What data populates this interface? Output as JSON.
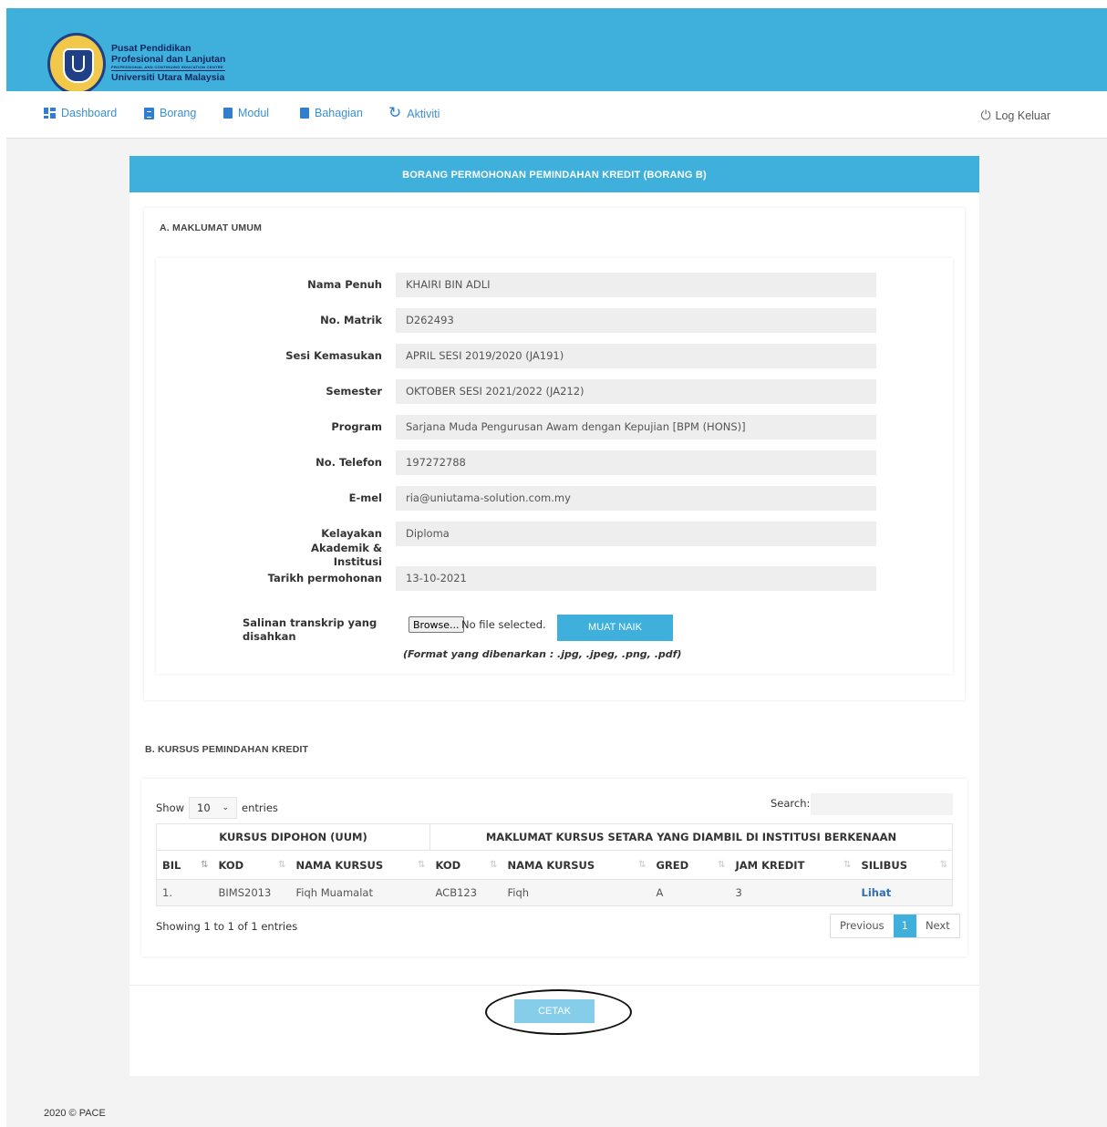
{
  "brand": {
    "line1": "Pusat Pendidikan",
    "line2": "Profesional dan Lanjutan",
    "line3": "PROFESSIONAL AND CONTINUING EDUCATION CENTRE",
    "line4": "Universiti Utara Malaysia"
  },
  "nav": {
    "items": [
      {
        "label": "Dashboard",
        "icon": "dashboard-icon"
      },
      {
        "label": "Borang",
        "icon": "form-icon"
      },
      {
        "label": "Modul",
        "icon": "book-icon"
      },
      {
        "label": "Bahagian",
        "icon": "book-icon"
      },
      {
        "label": "Aktiviti",
        "icon": "refresh-icon"
      }
    ],
    "logout": "Log Keluar"
  },
  "form": {
    "title": "BORANG PERMOHONAN PEMINDAHAN KREDIT (BORANG B)",
    "sectionA": {
      "title": "A. MAKLUMAT UMUM",
      "fields": [
        {
          "label": "Nama Penuh",
          "value": "KHAIRI BIN ADLI"
        },
        {
          "label": "No. Matrik",
          "value": "D262493"
        },
        {
          "label": "Sesi Kemasukan",
          "value": "APRIL SESI 2019/2020 (JA191)"
        },
        {
          "label": "Semester",
          "value": "OKTOBER SESI 2021/2022 (JA212)"
        },
        {
          "label": "Program",
          "value": "Sarjana Muda Pengurusan Awam dengan Kepujian [BPM (HONS)]"
        },
        {
          "label": "No. Telefon",
          "value": "197272788"
        },
        {
          "label": "E-mel",
          "value": "ria@uniutama-solution.com.my"
        },
        {
          "label": "Kelayakan Akademik & Institusi",
          "value": "Diploma"
        },
        {
          "label": "Tarikh permohonan",
          "value": "13-10-2021"
        }
      ],
      "upload": {
        "label": "Salinan transkrip yang disahkan",
        "browse": "Browse...",
        "no_file": "No file selected.",
        "button": "MUAT NAIK",
        "note": "(Format yang dibenarkan : .jpg, .jpeg, .png, .pdf)"
      }
    },
    "sectionB": {
      "title": "B. KURSUS PEMINDAHAN KREDIT",
      "show": "Show",
      "entries_value": "10",
      "entries": "entries",
      "search": "Search:",
      "group1": "KURSUS DIPOHON (UUM)",
      "group2": "MAKLUMAT KURSUS SETARA YANG DIAMBIL DI INSTITUSI BERKENAAN",
      "columns": [
        "BIL",
        "KOD",
        "NAMA KURSUS",
        "KOD",
        "NAMA KURSUS",
        "GRED",
        "JAM KREDIT",
        "SILIBUS"
      ],
      "rows": [
        [
          "1.",
          "BIMS2013",
          "Fiqh Muamalat",
          "ACB123",
          "Fiqh",
          "A",
          "3",
          "Lihat"
        ]
      ],
      "info": "Showing 1 to 1 of 1 entries",
      "pager": {
        "previous": "Previous",
        "current": "1",
        "next": "Next"
      }
    },
    "print": "CETAK"
  },
  "footer": "2020 © PACE",
  "colors": {
    "primary": "#3fb0dc",
    "nav_link": "#3a8fd6",
    "print_button": "#86cdea"
  }
}
